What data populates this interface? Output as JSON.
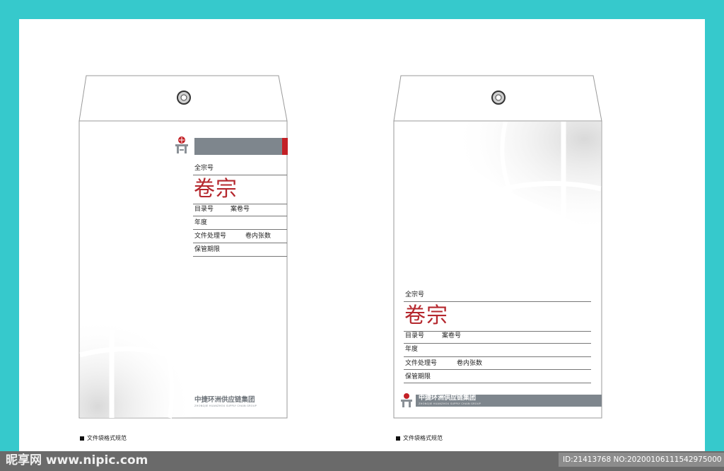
{
  "envelope_left": {
    "form": {
      "fonds_no": "全宗号",
      "title": "卷宗",
      "catalog_no": "目录号",
      "file_no": "案卷号",
      "year": "年度",
      "doc_process_no": "文件处理号",
      "page_count": "卷内张数",
      "retention": "保管期限"
    },
    "brand_name": "中捷环洲供应链集团",
    "brand_en": "ZHONGJIE HUANZHOU SUPPLY CHAIN GROUP",
    "caption": "文件袋格式规范"
  },
  "envelope_right": {
    "form": {
      "fonds_no": "全宗号",
      "title": "卷宗",
      "catalog_no": "目录号",
      "file_no": "案卷号",
      "year": "年度",
      "doc_process_no": "文件处理号",
      "page_count": "卷内张数",
      "retention": "保管期限"
    },
    "brand_name": "中捷环洲供应链集团",
    "brand_en": "ZHONGJIE HUANZHOU SUPPLY CHAIN GROUP",
    "caption": "文件袋格式规范"
  },
  "watermark": {
    "site": "昵享网 www.nipic.com",
    "id_text": "ID:21413768 NO:20200106111542975000"
  },
  "colors": {
    "background": "#36c9cc",
    "band_gray": "#7e868d",
    "title_red": "#b5282e",
    "tab_red": "#c32026"
  }
}
